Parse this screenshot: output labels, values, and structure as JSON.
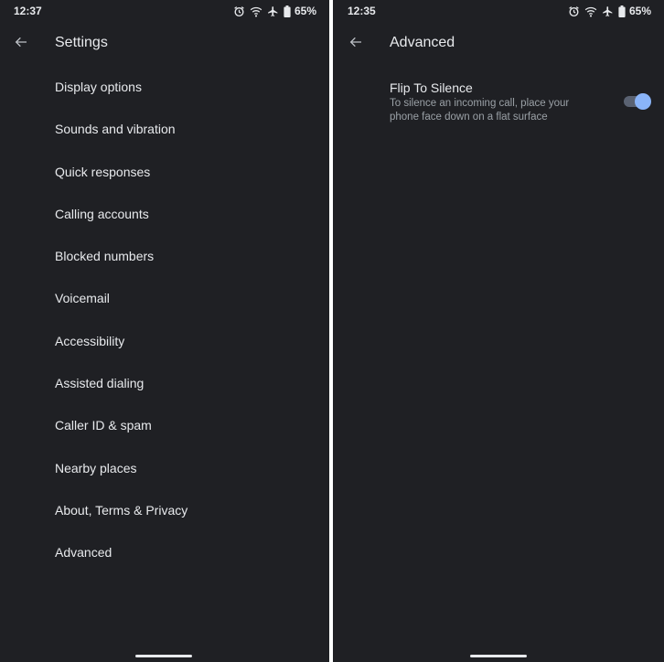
{
  "left_screen": {
    "status_bar": {
      "time": "12:37",
      "icons": [
        "alarm-icon",
        "wifi-icon",
        "airplane-mode-icon",
        "battery-icon"
      ],
      "battery_percent": "65%"
    },
    "app_bar": {
      "back_icon": "arrow-back-icon",
      "title": "Settings"
    },
    "menu_items": [
      {
        "label": "Display options"
      },
      {
        "label": "Sounds and vibration"
      },
      {
        "label": "Quick responses"
      },
      {
        "label": "Calling accounts"
      },
      {
        "label": "Blocked numbers"
      },
      {
        "label": "Voicemail"
      },
      {
        "label": "Accessibility"
      },
      {
        "label": "Assisted dialing"
      },
      {
        "label": "Caller ID & spam"
      },
      {
        "label": "Nearby places"
      },
      {
        "label": "About, Terms & Privacy"
      },
      {
        "label": "Advanced"
      }
    ]
  },
  "right_screen": {
    "status_bar": {
      "time": "12:35",
      "icons": [
        "alarm-icon",
        "wifi-icon",
        "airplane-mode-icon",
        "battery-icon"
      ],
      "battery_percent": "65%"
    },
    "app_bar": {
      "back_icon": "arrow-back-icon",
      "title": "Advanced"
    },
    "preference": {
      "title": "Flip To Silence",
      "summary": "To silence an incoming call, place your phone face down on a flat surface",
      "toggle_on": true
    }
  },
  "colors": {
    "background": "#1f2024",
    "text_primary": "#e8eaed",
    "text_secondary": "#9aa0a6",
    "accent": "#8ab4f8"
  }
}
